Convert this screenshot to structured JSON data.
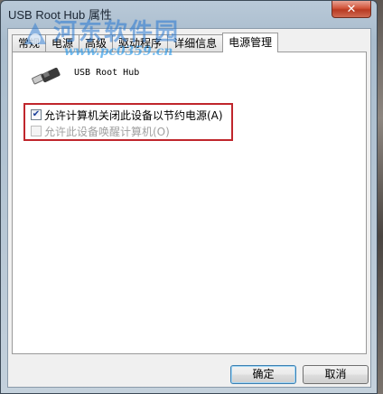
{
  "window": {
    "title": "USB Root Hub 属性",
    "close_glyph": "✕"
  },
  "watermark": {
    "site_name": "河东软件园",
    "url": "www.pc0359.cn",
    "color": "#2878d2"
  },
  "tabs": [
    {
      "label": "常规",
      "active": false
    },
    {
      "label": "电源",
      "active": false
    },
    {
      "label": "高级",
      "active": false
    },
    {
      "label": "驱动程序",
      "active": false
    },
    {
      "label": "详细信息",
      "active": false
    },
    {
      "label": "电源管理",
      "active": true
    }
  ],
  "device": {
    "name": "USB Root Hub",
    "icon": "usb-plug-icon"
  },
  "options": {
    "allow_turn_off": {
      "label": "允许计算机关闭此设备以节约电源(A)",
      "checked": true,
      "enabled": true
    },
    "allow_wake": {
      "label": "允许此设备唤醒计算机(O)",
      "checked": false,
      "enabled": false
    },
    "highlight_color": "#c0262c"
  },
  "buttons": {
    "ok": "确定",
    "cancel": "取消"
  }
}
